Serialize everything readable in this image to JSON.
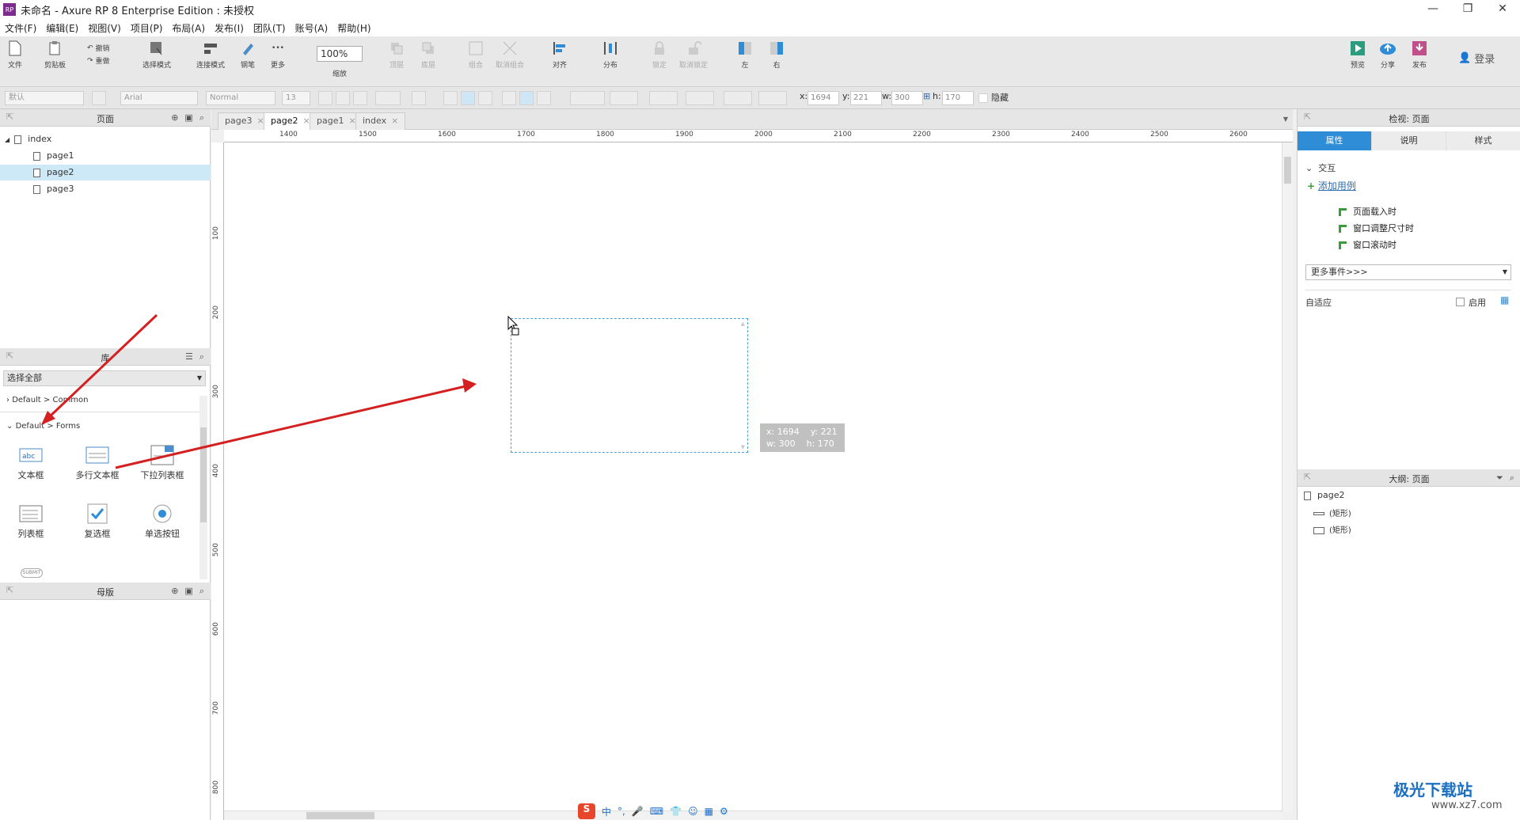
{
  "window": {
    "title": "未命名 - Axure RP 8 Enterprise Edition : 未授权",
    "app_icon": "RP"
  },
  "menu": [
    "文件(F)",
    "编辑(E)",
    "视图(V)",
    "项目(P)",
    "布局(A)",
    "发布(I)",
    "团队(T)",
    "账号(A)",
    "帮助(H)"
  ],
  "toolbar": {
    "file": "文件",
    "clipboard": "剪贴板",
    "undo": "撤销",
    "redo": "重做",
    "select_mode": "选择模式",
    "connect_mode": "连接模式",
    "pen": "钢笔",
    "more": "更多",
    "zoom_value": "100%",
    "zoom_label": "缩放",
    "top": "顶层",
    "bottom": "底层",
    "group": "组合",
    "ungroup": "取消组合",
    "align": "对齐",
    "distribute": "分布",
    "lock": "锁定",
    "unlock": "取消锁定",
    "left": "左",
    "right": "右",
    "preview": "预览",
    "share": "分享",
    "publish": "发布",
    "login": "登录"
  },
  "format": {
    "style": "默认",
    "font": "Arial",
    "weight": "Normal",
    "size": "13",
    "x_label": "x:",
    "x": "1694",
    "y_label": "y:",
    "y": "221",
    "w_label": "w:",
    "w": "300",
    "h_label": "h:",
    "h": "170",
    "hidden": "隐藏"
  },
  "pages_panel": {
    "title": "页面",
    "root": "index",
    "pages": [
      "page1",
      "page2",
      "page3"
    ],
    "selected": "page2"
  },
  "library_panel": {
    "title": "库",
    "select": "选择全部",
    "group1": "Default > Common",
    "group2": "Default > Forms",
    "widgets": [
      "文本框",
      "多行文本框",
      "下拉列表框",
      "列表框",
      "复选框",
      "单选按钮"
    ],
    "submit": "SUBMIT"
  },
  "master_panel": {
    "title": "母版"
  },
  "tabs": [
    "page3",
    "page2",
    "page1",
    "index"
  ],
  "ruler_h": [
    "1400",
    "1500",
    "1600",
    "1700",
    "1800",
    "1900",
    "2000",
    "2100",
    "2200",
    "2300",
    "2400",
    "2500",
    "2600"
  ],
  "ruler_v": [
    "100",
    "200",
    "300",
    "400",
    "500",
    "600",
    "700",
    "800"
  ],
  "tooltip": {
    "x": "x: 1694",
    "y": "y: 221",
    "w": "w: 300",
    "h": "h: 170"
  },
  "inspect": {
    "title": "检视: 页面",
    "tabs": [
      "属性",
      "说明",
      "样式"
    ],
    "interaction": "交互",
    "add_case": "添加用例",
    "events": [
      "页面载入时",
      "窗口调整尺寸时",
      "窗口滚动时"
    ],
    "more_events": "更多事件>>>",
    "adaptive": "自适应",
    "enable": "启用"
  },
  "outline": {
    "title": "大纲: 页面",
    "page": "page2",
    "items": [
      "(矩形)",
      "(矩形)"
    ]
  },
  "ime": [
    "中",
    "°,"
  ],
  "watermark": {
    "name": "极光下载站",
    "url": "www.xz7.com"
  }
}
